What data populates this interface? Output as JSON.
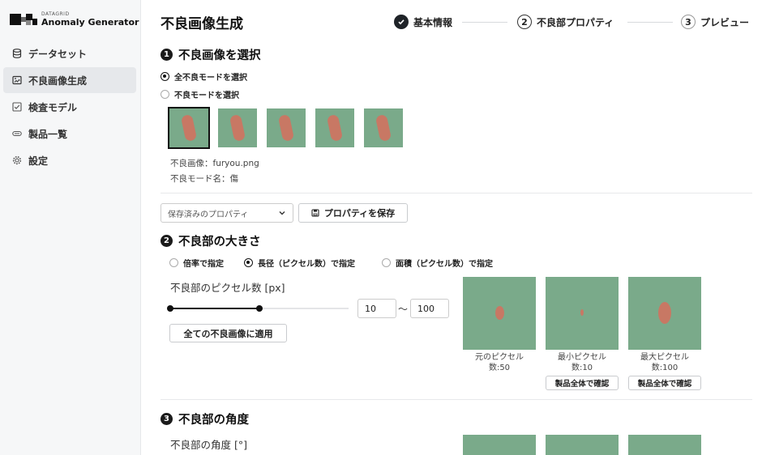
{
  "app": {
    "brand_small": "DATAGRID",
    "brand_name": "Anomaly Generator"
  },
  "sidebar": {
    "items": [
      {
        "label": "データセット",
        "icon": "database-icon",
        "active": false
      },
      {
        "label": "不良画像生成",
        "icon": "image-generate-icon",
        "active": true
      },
      {
        "label": "検査モデル",
        "icon": "checklist-icon",
        "active": false
      },
      {
        "label": "製品一覧",
        "icon": "tag-icon",
        "active": false
      },
      {
        "label": "設定",
        "icon": "gear-icon",
        "active": false
      }
    ]
  },
  "page": {
    "title": "不良画像生成"
  },
  "stepper": {
    "steps": [
      {
        "label": "基本情報",
        "marker": "✓",
        "state": "done"
      },
      {
        "label": "不良部プロパティ",
        "marker": "2",
        "state": "current"
      },
      {
        "label": "プレビュー",
        "marker": "3",
        "state": "pending"
      }
    ]
  },
  "section1": {
    "badge": "1",
    "title": "不良画像を選択",
    "radio_all": "全不良モードを選択",
    "radio_mode": "不良モードを選択",
    "image_label": "不良画像：furyou.png",
    "mode_label": "不良モード名：傷"
  },
  "toolbar": {
    "saved_props_placeholder": "保存済みのプロパティ",
    "save_props_button": "プロパティを保存"
  },
  "section2": {
    "badge": "2",
    "title": "不良部の大きさ",
    "radio_ratio": "倍率で指定",
    "radio_length": "長径（ピクセル数）で指定",
    "radio_area": "面積（ピクセル数）で指定",
    "field_label": "不良部のピクセル数 [px]",
    "min_value": "10",
    "range_sep": "〜",
    "max_value": "100",
    "slider_min_fraction": 0.0,
    "slider_max_fraction": 0.5,
    "apply_all_button": "全ての不良画像に適用",
    "previews": [
      {
        "caption_1": "元のピクセル",
        "caption_2": "数:50",
        "button": ""
      },
      {
        "caption_1": "最小ピクセル",
        "caption_2": "数:10",
        "button": "製品全体で確認"
      },
      {
        "caption_1": "最大ピクセル",
        "caption_2": "数:100",
        "button": "製品全体で確認"
      }
    ]
  },
  "section3": {
    "badge": "3",
    "title": "不良部の角度",
    "field_label": "不良部の角度 [°]"
  },
  "colors": {
    "preview_bg": "#7aaa8a",
    "defect": "#c87864",
    "accent_dark": "#1f2328"
  }
}
